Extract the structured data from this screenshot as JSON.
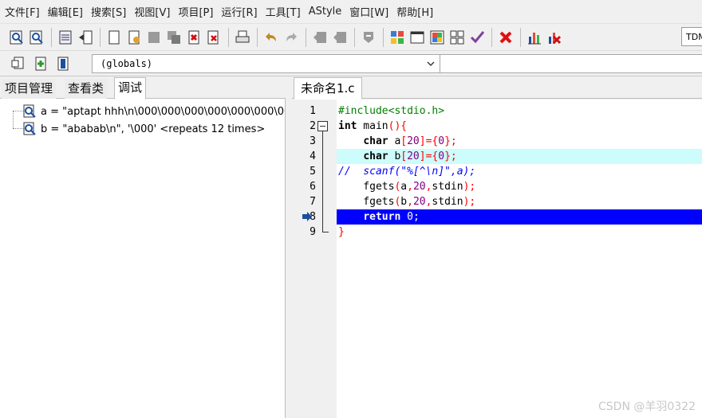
{
  "menubar": {
    "items": [
      "文件[F]",
      "编辑[E]",
      "搜索[S]",
      "视图[V]",
      "项目[P]",
      "运行[R]",
      "工具[T]",
      "AStyle",
      "窗口[W]",
      "帮助[H]"
    ]
  },
  "toolbar": {
    "scope_value": "(globals)",
    "compiler_value": "TDM"
  },
  "left_panel": {
    "tabs": [
      "项目管理",
      "查看类",
      "调试"
    ],
    "active_tab": "调试",
    "watches": [
      "a = \"aptapt hhh\\n\\000\\000\\000\\000\\000\\000\\000\\000\\000",
      "b = \"ababab\\n\", '\\000' <repeats 12 times>"
    ]
  },
  "editor": {
    "tab_label": "未命名1.c",
    "line_numbers": [
      "1",
      "2",
      "3",
      "4",
      "5",
      "6",
      "7",
      "8",
      "9"
    ],
    "lines": [
      [
        {
          "t": "#include<stdio.h>",
          "c": "pp"
        }
      ],
      [
        {
          "t": "int",
          "c": "kw"
        },
        {
          "t": " main",
          "c": "plain"
        },
        {
          "t": "(){",
          "c": "op"
        }
      ],
      [
        {
          "t": "    ",
          "c": "plain"
        },
        {
          "t": "char",
          "c": "kw"
        },
        {
          "t": " a",
          "c": "plain"
        },
        {
          "t": "[",
          "c": "op"
        },
        {
          "t": "20",
          "c": "num"
        },
        {
          "t": "]={",
          "c": "op"
        },
        {
          "t": "0",
          "c": "num"
        },
        {
          "t": "};",
          "c": "op"
        }
      ],
      [
        {
          "t": "    ",
          "c": "plain"
        },
        {
          "t": "char",
          "c": "kw"
        },
        {
          "t": " b",
          "c": "plain"
        },
        {
          "t": "[",
          "c": "op"
        },
        {
          "t": "20",
          "c": "num"
        },
        {
          "t": "]={",
          "c": "op"
        },
        {
          "t": "0",
          "c": "num"
        },
        {
          "t": "};",
          "c": "op"
        }
      ],
      [
        {
          "t": "//  scanf(\"%[^\\n]\",a);",
          "c": "cm"
        }
      ],
      [
        {
          "t": "    fgets",
          "c": "plain"
        },
        {
          "t": "(",
          "c": "op"
        },
        {
          "t": "a",
          "c": "plain"
        },
        {
          "t": ",",
          "c": "op"
        },
        {
          "t": "20",
          "c": "num"
        },
        {
          "t": ",",
          "c": "op"
        },
        {
          "t": "stdin",
          "c": "plain"
        },
        {
          "t": ");",
          "c": "op"
        }
      ],
      [
        {
          "t": "    fgets",
          "c": "plain"
        },
        {
          "t": "(",
          "c": "op"
        },
        {
          "t": "b",
          "c": "plain"
        },
        {
          "t": ",",
          "c": "op"
        },
        {
          "t": "20",
          "c": "num"
        },
        {
          "t": ",",
          "c": "op"
        },
        {
          "t": "stdin",
          "c": "plain"
        },
        {
          "t": ");",
          "c": "op"
        }
      ],
      [
        {
          "t": "    ",
          "c": "plain"
        },
        {
          "t": "return",
          "c": "kw"
        },
        {
          "t": " ",
          "c": "plain"
        },
        {
          "t": "0",
          "c": "num"
        },
        {
          "t": ";",
          "c": "op"
        }
      ],
      [
        {
          "t": "}",
          "c": "op"
        }
      ]
    ],
    "highlight_cyan_line": 4,
    "highlight_exec_line": 8
  },
  "watermark": "CSDN @羊羽0322",
  "colors": {
    "exec_line": "#0000ff",
    "selected_line": "#ccfcfc",
    "preprocessor": "#008000",
    "number": "#800080",
    "symbol": "#ff0000",
    "comment": "#0000ff"
  }
}
